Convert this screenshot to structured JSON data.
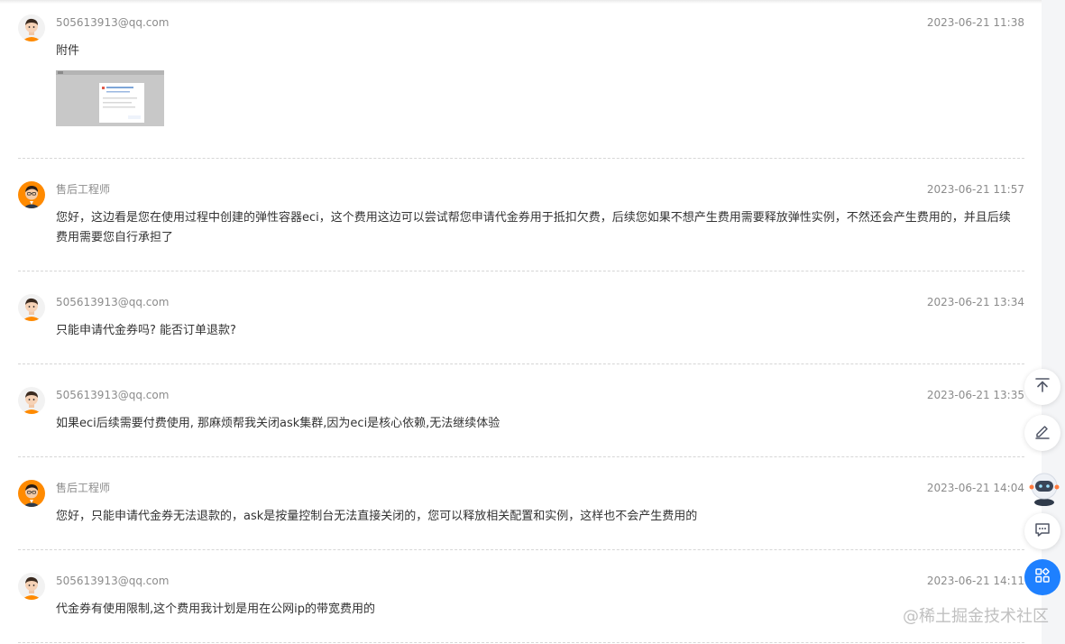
{
  "messages": [
    {
      "name": "505613913@qq.com",
      "time": "2023-06-21 11:38",
      "content": "附件",
      "avatar": "user-avatar",
      "has_attachment": true
    },
    {
      "name": "售后工程师",
      "time": "2023-06-21 11:57",
      "content": "您好，这边看是您在使用过程中创建的弹性容器eci，这个费用这边可以尝试帮您申请代金券用于抵扣欠费，后续您如果不想产生费用需要释放弹性实例，不然还会产生费用的，并且后续费用需要您自行承担了",
      "avatar": "engineer-avatar"
    },
    {
      "name": "505613913@qq.com",
      "time": "2023-06-21 13:34",
      "content": "只能申请代金券吗? 能否订单退款?",
      "avatar": "user-avatar"
    },
    {
      "name": "505613913@qq.com",
      "time": "2023-06-21 13:35",
      "content": "如果eci后续需要付费使用, 那麻烦帮我关闭ask集群,因为eci是核心依赖,无法继续体验",
      "avatar": "user-avatar"
    },
    {
      "name": "售后工程师",
      "time": "2023-06-21 14:04",
      "content": "您好，只能申请代金券无法退款的，ask是按量控制台无法直接关闭的，您可以释放相关配置和实例，这样也不会产生费用的",
      "avatar": "engineer-avatar"
    },
    {
      "name": "505613913@qq.com",
      "time": "2023-06-21 14:11",
      "content": "代金券有使用限制,这个费用我计划是用在公网ip的带宽费用的",
      "avatar": "user-avatar"
    }
  ],
  "sidebar": {
    "icons": [
      "arrow-to-top-icon",
      "edit-pen-icon",
      "robot-assistant-icon",
      "comment-icon",
      "apps-grid-icon"
    ]
  },
  "watermark": "@稀土掘金技术社区",
  "colors": {
    "accent": "#1e80ff",
    "text": "#333333",
    "meta": "#8c8c8c",
    "separator": "#d6d6d6",
    "avatar_shirt": "#ff8a00"
  }
}
